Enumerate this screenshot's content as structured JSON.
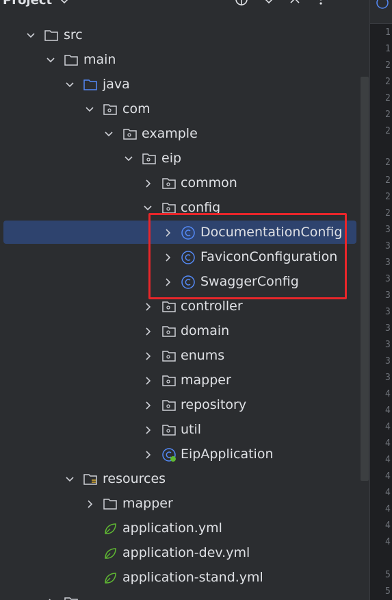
{
  "header": {
    "title": "Project"
  },
  "tree": {
    "src": "src",
    "main": "main",
    "java": "java",
    "com": "com",
    "example": "example",
    "eip": "eip",
    "common": "common",
    "config": "config",
    "documentation_config": "DocumentationConfig",
    "favicon_configuration": "FaviconConfiguration",
    "swagger_config": "SwaggerConfig",
    "controller": "controller",
    "domain": "domain",
    "enums": "enums",
    "mapper": "mapper",
    "repository": "repository",
    "util": "util",
    "eip_application": "EipApplication",
    "resources": "resources",
    "resources_mapper": "mapper",
    "application_yml": "application.yml",
    "application_dev_yml": "application-dev.yml",
    "application_stand_yml": "application-stand.yml"
  },
  "gutter": {
    "line_numbers": [
      "1",
      "1",
      "2",
      "2",
      "2",
      "2",
      "2",
      "2",
      "2",
      "2",
      "2",
      "3",
      "3",
      "3",
      "3",
      "3",
      "3",
      "3",
      "3",
      "3",
      "3",
      "4",
      "4",
      "4",
      "4",
      "4",
      "4",
      "4",
      "4",
      "4",
      "4",
      "5",
      "5"
    ]
  },
  "colors": {
    "background": "#2b2d30",
    "selection": "#2e436e",
    "highlight_border": "#e8262a",
    "java_folder": "#548af7",
    "class_icon": "#548af7",
    "spring_icon": "#5fb832"
  }
}
